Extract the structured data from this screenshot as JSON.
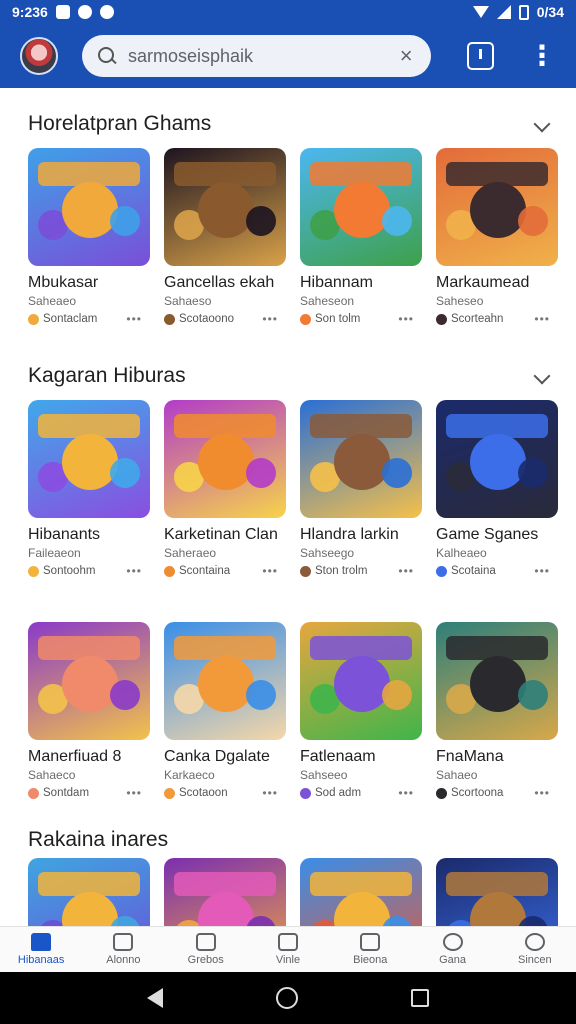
{
  "status_bar": {
    "time": "9:236",
    "battery": "0/34"
  },
  "search": {
    "query": "sarmoseisphaik"
  },
  "sections": [
    {
      "title": "Horelatpran Ghams",
      "cards": [
        {
          "title": "Mbukasar",
          "subtitle": "Saheaeo",
          "meta": "Sontaclam",
          "colors": [
            "#3fa0e8",
            "#f0a93a",
            "#7a4fd8"
          ]
        },
        {
          "title": "Gancellas ekah",
          "subtitle": "Sahaeso",
          "meta": "Scotaoono",
          "colors": [
            "#1c1420",
            "#8a5a2e",
            "#d9a24a"
          ]
        },
        {
          "title": "Hibannam",
          "subtitle": "Saheseon",
          "meta": "Son tolm",
          "colors": [
            "#4cb7f0",
            "#f27a32",
            "#3ea04a"
          ]
        },
        {
          "title": "Markaumead",
          "subtitle": "Saheseo",
          "meta": "Scorteahn",
          "colors": [
            "#e36b3a",
            "#3b2b2e",
            "#f0b14a"
          ]
        }
      ]
    },
    {
      "title": "Kagaran Hiburas",
      "cards": [
        {
          "title": "Hibanants",
          "subtitle": "Faileaeon",
          "meta": "Sontoohm",
          "colors": [
            "#40a8ea",
            "#f2b43a",
            "#8a4ee0"
          ]
        },
        {
          "title": "Karketinan Clan",
          "subtitle": "Saheraeo",
          "meta": "Scontaina",
          "colors": [
            "#b23cc9",
            "#f08c2e",
            "#f7d34a"
          ]
        },
        {
          "title": "Hlandra larkin",
          "subtitle": "Sahseego",
          "meta": "Ston trolm",
          "colors": [
            "#2a6fd6",
            "#8a5a3a",
            "#f5c04a"
          ]
        },
        {
          "title": "Game Sganes",
          "subtitle": "Kalheaeo",
          "meta": "Scotaina",
          "colors": [
            "#1b2a6b",
            "#3b6ee8",
            "#2a2a3a"
          ]
        }
      ]
    },
    {
      "title": "",
      "cards": [
        {
          "title": "Manerfiuad 8",
          "subtitle": "Sahaeco",
          "meta": "Sontdam",
          "colors": [
            "#8a3ac9",
            "#f08a6a",
            "#f3c24a"
          ]
        },
        {
          "title": "Canka Dgalate",
          "subtitle": "Karkaeco",
          "meta": "Scotaoon",
          "colors": [
            "#3a8ee8",
            "#f29a3a",
            "#f5d7a8"
          ]
        },
        {
          "title": "Fatlenaam",
          "subtitle": "Sahseeo",
          "meta": "Sod adm",
          "colors": [
            "#e6a640",
            "#7b52d8",
            "#3fb54a"
          ]
        },
        {
          "title": "FnaMana",
          "subtitle": "Sahaeo",
          "meta": "Scortoona",
          "colors": [
            "#2e7f7a",
            "#2a2a2e",
            "#d7a84a"
          ]
        }
      ]
    },
    {
      "title": "Rakaina inares",
      "cards": [
        {
          "colors": [
            "#3fa5e0",
            "#f2b43a",
            "#6a4ed8"
          ]
        },
        {
          "colors": [
            "#7a2fb0",
            "#e35ab8",
            "#f3a640"
          ]
        },
        {
          "colors": [
            "#3a8ee8",
            "#f2b43a",
            "#e35a3a"
          ]
        },
        {
          "colors": [
            "#1b2a6b",
            "#b0783a",
            "#3a6ee8"
          ]
        }
      ]
    }
  ],
  "bottom_nav": [
    {
      "label": "Hibanaas",
      "active": true
    },
    {
      "label": "Alonno"
    },
    {
      "label": "Grebos"
    },
    {
      "label": "Vinle"
    },
    {
      "label": "Bieona"
    },
    {
      "label": "Gana"
    },
    {
      "label": "Sincen"
    }
  ],
  "accent_color": "#1a4fb3"
}
